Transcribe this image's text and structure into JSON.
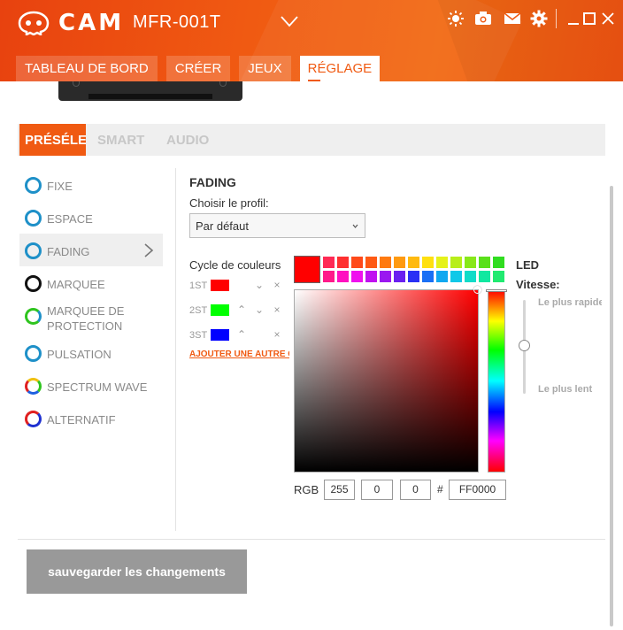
{
  "header": {
    "brand": "CAM",
    "device": "MFR-001T",
    "icons": [
      "logo-icon",
      "chevron-down-icon",
      "brightness-icon",
      "camera-icon",
      "mail-icon",
      "gear-icon",
      "minimize-icon",
      "maximize-icon",
      "close-icon"
    ]
  },
  "nav": {
    "tabs": [
      {
        "label": "TABLEAU DE BORD"
      },
      {
        "label": "CRÉER"
      },
      {
        "label": "JEUX"
      },
      {
        "label": "RÉGLAGE"
      }
    ],
    "active": "RÉGLAGE"
  },
  "subtabs": {
    "items": [
      "PRÉSÉLE",
      "SMART",
      "AUDIO"
    ],
    "active": "PRÉSÉLE"
  },
  "modes": [
    {
      "label": "FIXE",
      "ring": "#1e90c8"
    },
    {
      "label": "ESPACE",
      "ring": "#1e90c8"
    },
    {
      "label": "FADING",
      "ring": "#1e90c8",
      "active": true
    },
    {
      "label": "MARQUEE",
      "ring": "#111111"
    },
    {
      "label": "MARQUEE DE PROTECTION",
      "ring": "gradient-green-blue"
    },
    {
      "label": "PULSATION",
      "ring": "#1e90c8"
    },
    {
      "label": "SPECTRUM WAVE",
      "ring": "rainbow"
    },
    {
      "label": "ALTERNATIF",
      "ring": "red-blue"
    }
  ],
  "fading": {
    "title": "FADING",
    "profile_label": "Choisir le profil:",
    "profile_value": "Par défaut",
    "cycle_label": "Cycle de couleurs",
    "cycle": [
      {
        "index": "1ST",
        "color": "#ff0000",
        "controls": [
          "⌄",
          "×"
        ]
      },
      {
        "index": "2ST",
        "color": "#00ff00",
        "controls": [
          "⌃",
          "⌄",
          "×"
        ]
      },
      {
        "index": "3ST",
        "color": "#0000ff",
        "controls": [
          "⌃",
          "×"
        ]
      }
    ],
    "add_link": "AJOUTER UNE AUTRE COULEUR"
  },
  "picker": {
    "current": "#ff0000",
    "palette_row1": [
      "#ff2a55",
      "#ff3030",
      "#ff4a1a",
      "#ff5a14",
      "#ff7a10",
      "#ff9a10",
      "#ffba10",
      "#ffe010",
      "#e5f21a",
      "#b8ee1a",
      "#88e81a",
      "#5ae01a",
      "#30dd20"
    ],
    "palette_row2": [
      "#ff1a8a",
      "#ff10c0",
      "#ef10ee",
      "#c010f0",
      "#9a18f0",
      "#6a20f0",
      "#2a30f5",
      "#1a70f5",
      "#10a8f0",
      "#10c8e8",
      "#10dcc8",
      "#10e8a0",
      "#20ea70"
    ],
    "rgb_label": "RGB",
    "r": "255",
    "g": "0",
    "b": "0",
    "hash": "#",
    "hex": "FF0000"
  },
  "led": {
    "title": "LED",
    "speed_label": "Vitesse:",
    "fast": "Le plus rapide",
    "slow": "Le plus lent",
    "speed_level": 0.5
  },
  "save_label": "sauvegarder les changements",
  "accent": "#f05a12"
}
